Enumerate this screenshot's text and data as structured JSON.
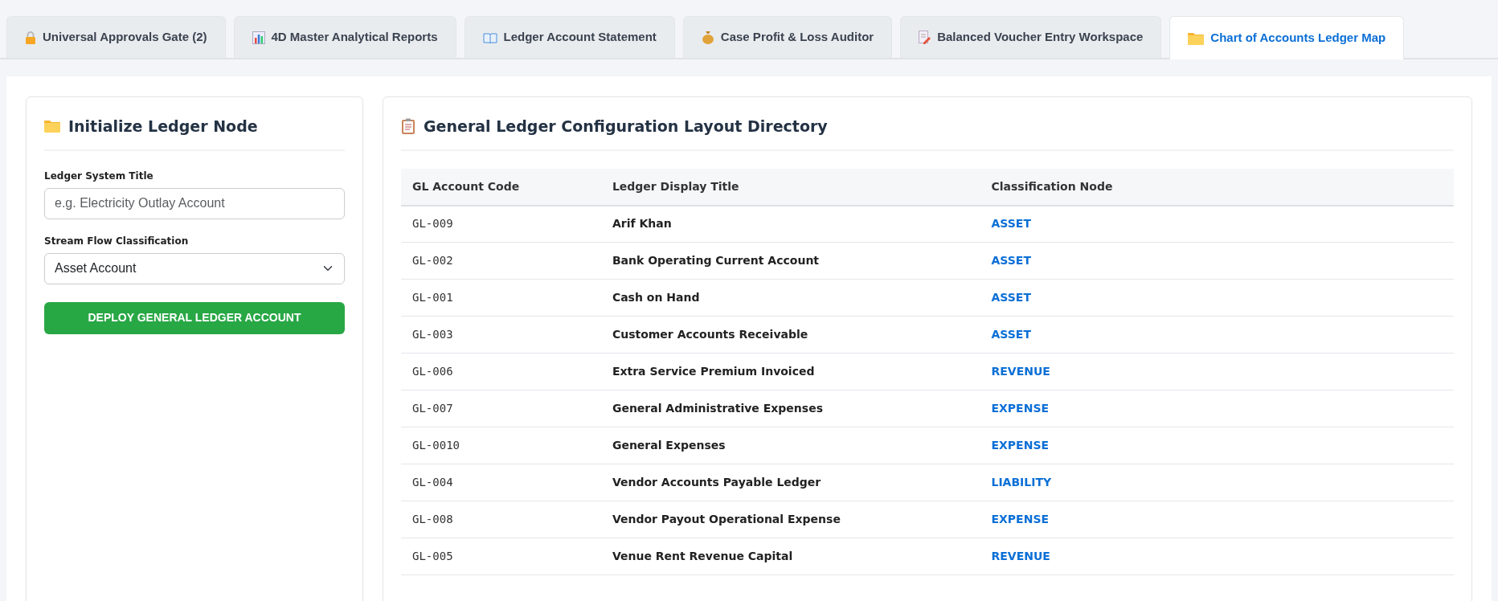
{
  "tabs": [
    {
      "label": "Universal Approvals Gate (2)",
      "selected": false
    },
    {
      "label": "4D Master Analytical Reports",
      "selected": false
    },
    {
      "label": "Ledger Account Statement",
      "selected": false
    },
    {
      "label": "Case Profit & Loss Auditor",
      "selected": false
    },
    {
      "label": "Balanced Voucher Entry Workspace",
      "selected": false
    },
    {
      "label": "Chart of Accounts Ledger Map",
      "selected": true
    }
  ],
  "form": {
    "title": "Initialize Ledger Node",
    "fields": [
      {
        "label": "Ledger System Title",
        "kind": "text",
        "placeholder": "e.g. Electricity Outlay Account"
      },
      {
        "label": "Stream Flow Classification",
        "kind": "select",
        "value": "Asset Account"
      }
    ],
    "submit": "DEPLOY GENERAL LEDGER ACCOUNT"
  },
  "table": {
    "title": "General Ledger Configuration Layout Directory",
    "columns": [
      "GL Account Code",
      "Ledger Display Title",
      "Classification Node"
    ],
    "rows": [
      [
        "GL-009",
        "Arif Khan",
        "ASSET"
      ],
      [
        "GL-002",
        "Bank Operating Current Account",
        "ASSET"
      ],
      [
        "GL-001",
        "Cash on Hand",
        "ASSET"
      ],
      [
        "GL-003",
        "Customer Accounts Receivable",
        "ASSET"
      ],
      [
        "GL-006",
        "Extra Service Premium Invoiced",
        "REVENUE"
      ],
      [
        "GL-007",
        "General Administrative Expenses",
        "EXPENSE"
      ],
      [
        "GL-0010",
        "General Expenses",
        "EXPENSE"
      ],
      [
        "GL-004",
        "Vendor Accounts Payable Ledger",
        "LIABILITY"
      ],
      [
        "GL-008",
        "Vendor Payout Operational Expense",
        "EXPENSE"
      ],
      [
        "GL-005",
        "Venue Rent Revenue Capital",
        "REVENUE"
      ]
    ]
  }
}
